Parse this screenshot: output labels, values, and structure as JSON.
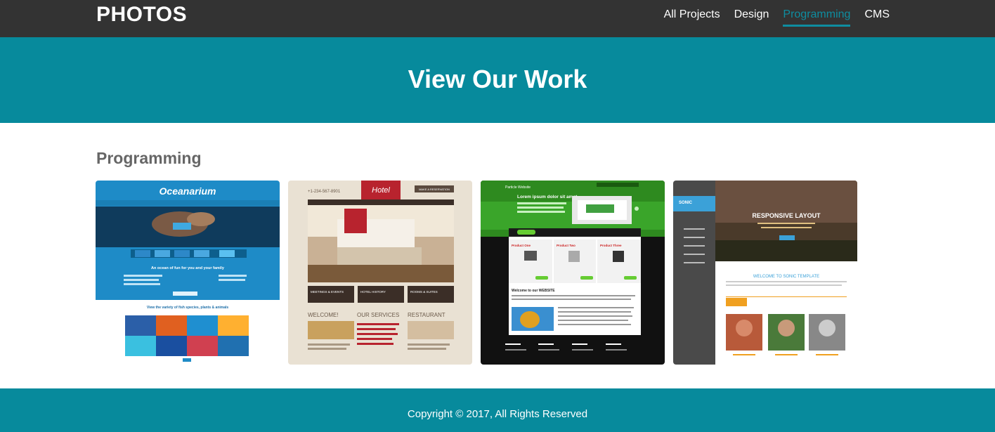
{
  "brand": "PHOTOS",
  "nav": {
    "items": [
      {
        "label": "All Projects",
        "active": false
      },
      {
        "label": "Design",
        "active": false
      },
      {
        "label": "Programming",
        "active": true
      },
      {
        "label": "CMS",
        "active": false
      }
    ]
  },
  "hero": {
    "title": "View Our Work"
  },
  "section": {
    "title": "Programming"
  },
  "projects": [
    {
      "site_title": "Oceanarium",
      "tagline": "An ocean of fun for you and your family",
      "caption": "View the variety of fish species, plants & animals"
    },
    {
      "site_title": "Hotel",
      "phone": "+1-234-567-8901",
      "cta": "MAKE A RESERVATION",
      "sections": [
        "MEETINGS & EVENTS",
        "HOTEL HISTORY",
        "ROOMS & SUITES"
      ],
      "columns": [
        "WELCOME!",
        "OUR SERVICES",
        "RESTAURANT"
      ]
    },
    {
      "site_title": "Particle Website",
      "headline": "Lorem ipsum dolor sit amet",
      "products": [
        "Product One",
        "Product Two",
        "Product Three"
      ],
      "welcome": "Welcome to our WEBSITE"
    },
    {
      "site_title": "SONIC",
      "hero_text": "RESPONSIVE LAYOUT",
      "welcome": "WELCOME TO SONIC TEMPLATE"
    }
  ],
  "footer": {
    "text": "Copyright © 2017, All Rights Reserved"
  },
  "colors": {
    "nav_bg": "#333333",
    "accent": "#078a9c",
    "active_link": "#0e8da0",
    "section_title": "#666666"
  }
}
